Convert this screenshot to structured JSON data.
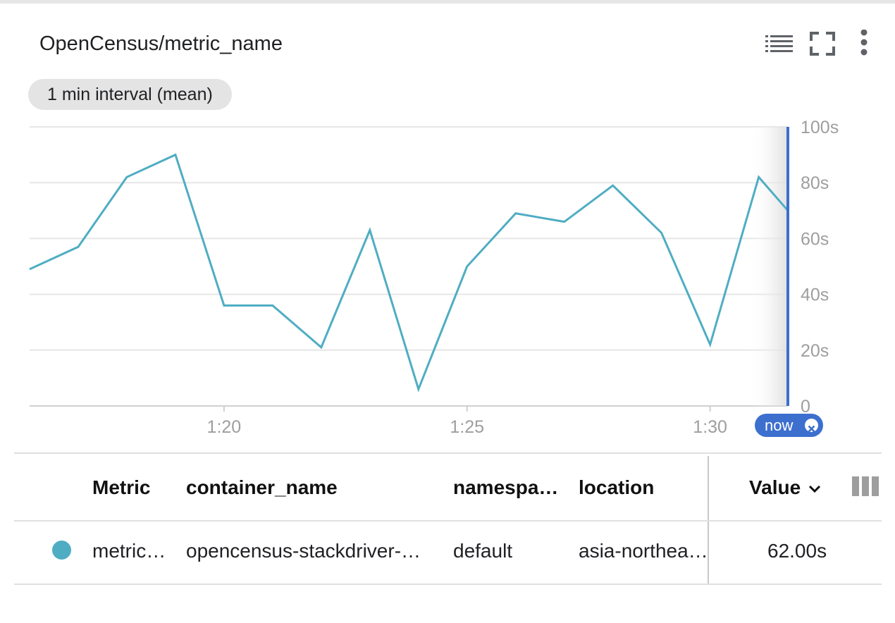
{
  "widget": {
    "title": "OpenCensus/metric_name",
    "interval_chip": "1 min interval (mean)",
    "toolbar": {
      "legend_icon": "list-icon",
      "fullscreen_icon": "fullscreen-icon",
      "more_icon": "more-vert-icon"
    },
    "now_label": "now",
    "now_close_icon": "close-circle-icon",
    "colors": {
      "series": "#4fadc3",
      "now_line": "#3c6fce",
      "grid": "#e6e6e6",
      "axis_text": "#9e9e9e"
    }
  },
  "chart_data": {
    "type": "line",
    "x_unit": "minutes (1:xx)",
    "x": [
      16,
      17,
      18,
      19,
      20,
      21,
      22,
      23,
      24,
      25,
      26,
      27,
      28,
      29,
      30,
      31,
      31.6
    ],
    "xlim": [
      16,
      31.6
    ],
    "now": 31.6,
    "y_ticks": [
      "0",
      "20s",
      "40s",
      "60s",
      "80s",
      "100s"
    ],
    "y_tick_values": [
      0,
      20,
      40,
      60,
      80,
      100
    ],
    "x_ticks": [
      "1:20",
      "1:25",
      "1:30"
    ],
    "x_tick_values": [
      20,
      25,
      30
    ],
    "ylim": [
      0,
      100
    ],
    "series": [
      {
        "values": [
          49,
          57,
          82,
          90,
          36,
          36,
          21,
          63,
          6,
          50,
          69,
          66,
          79,
          62,
          22,
          82,
          70
        ]
      }
    ],
    "grid": true
  },
  "table": {
    "headers": {
      "metric": "Metric",
      "container_name": "container_name",
      "namespace": "namespa…",
      "location": "location",
      "value": "Value"
    },
    "sort_icon": "chevron-down-icon",
    "columns_icon": "column-picker-icon",
    "rows": [
      {
        "color": "#4fadc3",
        "metric": "metric…",
        "container_name": "opencensus-stackdriver-…",
        "namespace": "default",
        "location": "asia-northea…",
        "value": "62.00s"
      }
    ]
  }
}
